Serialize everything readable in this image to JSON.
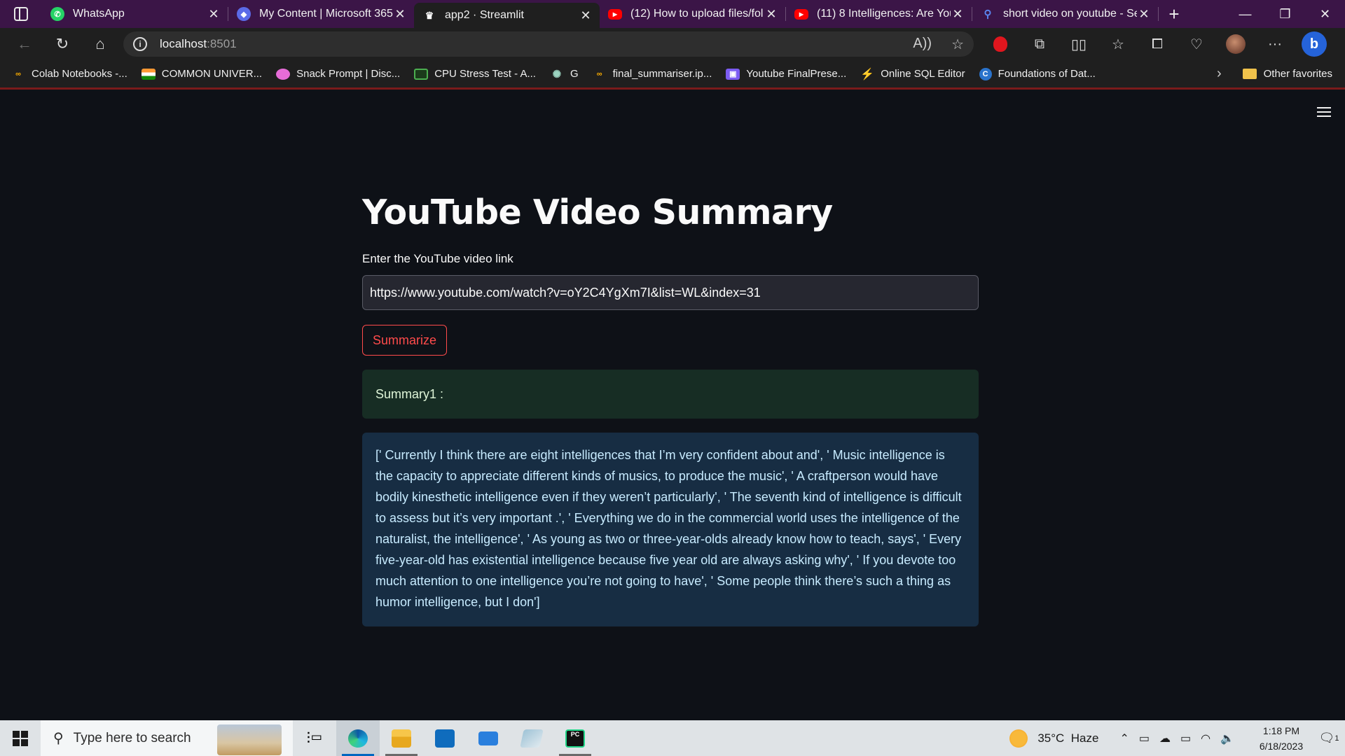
{
  "browser": {
    "tabs": [
      {
        "title": "WhatsApp",
        "icon": "whatsapp-icon",
        "color": "#25d366",
        "active": false
      },
      {
        "title": "My Content | Microsoft 365",
        "icon": "microsoft365-icon",
        "color": "#5b6be8",
        "active": false
      },
      {
        "title": "app2 · Streamlit",
        "icon": "streamlit-icon",
        "color": "#ff4b4b",
        "active": true
      },
      {
        "title": "(12) How to upload files/fol",
        "icon": "youtube-icon",
        "color": "#ff0000",
        "active": false
      },
      {
        "title": "(11) 8 Intelligences: Are You",
        "icon": "youtube-icon",
        "color": "#ff0000",
        "active": false
      },
      {
        "title": "short video on youtube - Se",
        "icon": "search-icon",
        "color": "#3b6fe0",
        "active": false
      }
    ],
    "address": {
      "host": "localhost",
      "port": ":8501"
    },
    "favorites": [
      {
        "label": "Colab Notebooks -...",
        "icon": "colab-icon",
        "color": "#f9ab00"
      },
      {
        "label": "COMMON UNIVER...",
        "icon": "india-flag-icon",
        "color": "#ff9933"
      },
      {
        "label": "Snack Prompt | Disc...",
        "icon": "snack-prompt-icon",
        "color": "#e66cd7"
      },
      {
        "label": "CPU Stress Test - A...",
        "icon": "cpu-icon",
        "color": "#4caf50"
      },
      {
        "label": "G",
        "icon": "chatgpt-icon",
        "color": "#9bd3c0"
      },
      {
        "label": "final_summariser.ip...",
        "icon": "colab-icon",
        "color": "#f9ab00"
      },
      {
        "label": "Youtube FinalPrese...",
        "icon": "canva-icon",
        "color": "#7c5cf2"
      },
      {
        "label": "Online SQL Editor",
        "icon": "sql-editor-icon",
        "color": "#8e3cf7"
      },
      {
        "label": "Foundations of Dat...",
        "icon": "coursera-icon",
        "color": "#2a73cc"
      }
    ],
    "other_favorites": "Other favorites"
  },
  "app": {
    "title": "YouTube Video Summary",
    "input_label": "Enter the YouTube video link",
    "input_value": "https://www.youtube.com/watch?v=oY2C4YgXm7I&list=WL&index=31",
    "button_label": "Summarize",
    "success_text": "Summary1 :",
    "summary_text": "[' Currently I think there are eight intelligences that I’m very confident about and', ' Music intelligence is the capacity to appreciate different kinds of musics, to produce the music', ' A craftperson would have bodily kinesthetic intelligence even if they weren’t particularly', ' The seventh kind of intelligence is difficult to assess but it’s very important .', ' Everything we do in the commercial world uses the intelligence of the naturalist, the intelligence', ' As young as two or three-year-olds already know how to teach, says', ' Every five-year-old has existential intelligence because five year old are always asking why', ' If you devote too much attention to one intelligence you’re not going to have', ' Some people think there’s such a thing as humor intelligence, but I don']"
  },
  "taskbar": {
    "search_placeholder": "Type here to search",
    "weather": "35°C  Haze",
    "time": "1:18 PM",
    "date": "6/18/2023",
    "notifications": "1"
  }
}
